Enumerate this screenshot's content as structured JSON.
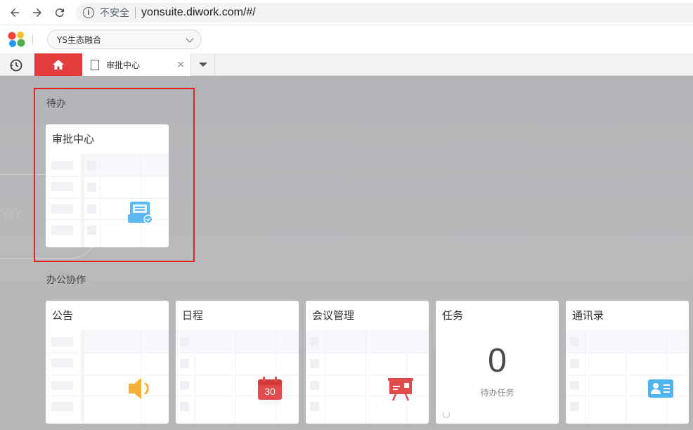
{
  "browser": {
    "security_label": "不安全",
    "url": "yonsuite.diwork.com/#/"
  },
  "header": {
    "tenant": "YS生态融合"
  },
  "tabs": {
    "open_tab_label": "审批中心"
  },
  "sections": {
    "todo_title": "待办",
    "office_title": "办公协作"
  },
  "cards": {
    "approval": {
      "title": "审批中心"
    },
    "notice": {
      "title": "公告"
    },
    "schedule": {
      "title": "日程",
      "calendar_day": "30"
    },
    "meeting": {
      "title": "会议管理"
    },
    "task": {
      "title": "任务",
      "count": "0",
      "label": "待办任务"
    },
    "contacts": {
      "title": "通讯录"
    }
  },
  "colors": {
    "brand_red": "#e23c3c",
    "highlight_red": "#e82020",
    "approval_icon": "#5bb8f0",
    "notice_icon": "#f7b136",
    "calendar_icon": "#e24b4b",
    "meeting_icon": "#e24b4b",
    "contacts_icon": "#4fb4ef"
  }
}
